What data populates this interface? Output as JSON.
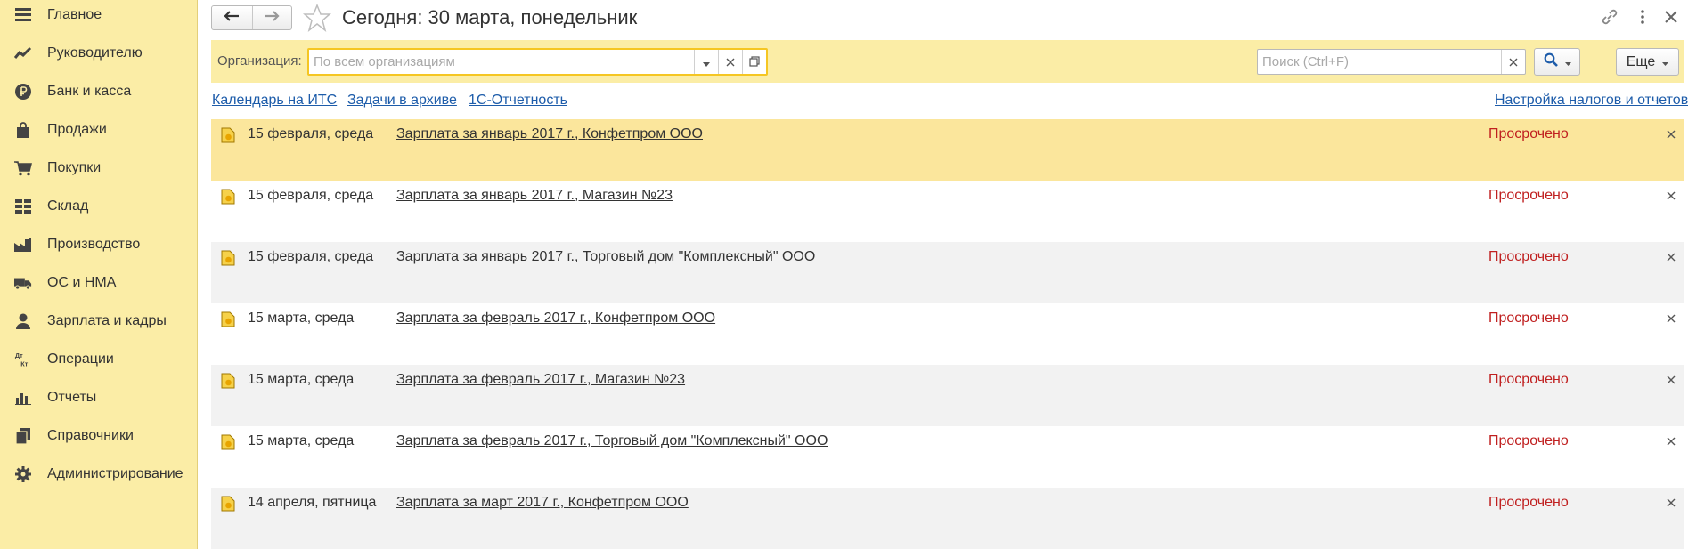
{
  "sidebar": {
    "items": [
      {
        "label": "Главное",
        "icon": "menu-lines-icon"
      },
      {
        "label": "Руководителю",
        "icon": "trend-chart-icon"
      },
      {
        "label": "Банк и касса",
        "icon": "ruble-coin-icon"
      },
      {
        "label": "Продажи",
        "icon": "shopping-bag-icon"
      },
      {
        "label": "Покупки",
        "icon": "shopping-cart-icon"
      },
      {
        "label": "Склад",
        "icon": "warehouse-grid-icon"
      },
      {
        "label": "Производство",
        "icon": "factory-icon"
      },
      {
        "label": "ОС и НМА",
        "icon": "truck-icon"
      },
      {
        "label": "Зарплата и кадры",
        "icon": "person-icon"
      },
      {
        "label": "Операции",
        "icon": "debit-credit-icon"
      },
      {
        "label": "Отчеты",
        "icon": "bar-chart-icon"
      },
      {
        "label": "Справочники",
        "icon": "books-icon"
      },
      {
        "label": "Администрирование",
        "icon": "gear-icon"
      }
    ],
    "debit_credit_glyph": "Дт\nКт"
  },
  "header": {
    "title": "Сегодня: 30 марта, понедельник"
  },
  "filter": {
    "org_label": "Организация:",
    "org_placeholder": "По всем организациям",
    "org_value": "",
    "search_placeholder": "Поиск (Ctrl+F)",
    "search_value": "",
    "more_label": "Еще"
  },
  "links": {
    "calendar": "Календарь на ИТС",
    "archive": "Задачи в архиве",
    "reporting": "1С-Отчетность",
    "settings": "Настройка налогов и отчетов"
  },
  "tasks": [
    {
      "date": "15 февраля, среда",
      "title": "Зарплата за январь 2017 г., Конфетпром ООО",
      "status": "Просрочено"
    },
    {
      "date": "15 февраля, среда",
      "title": "Зарплата за январь 2017 г., Магазин №23",
      "status": "Просрочено"
    },
    {
      "date": "15 февраля, среда",
      "title": "Зарплата за январь 2017 г., Торговый дом \"Комплексный\" ООО",
      "status": "Просрочено"
    },
    {
      "date": "15 марта, среда",
      "title": "Зарплата за февраль 2017 г., Конфетпром ООО",
      "status": "Просрочено"
    },
    {
      "date": "15 марта, среда",
      "title": "Зарплата за февраль 2017 г., Магазин №23",
      "status": "Просрочено"
    },
    {
      "date": "15 марта, среда",
      "title": "Зарплата за февраль 2017 г., Торговый дом \"Комплексный\" ООО",
      "status": "Просрочено"
    },
    {
      "date": "14 апреля, пятница",
      "title": "Зарплата за март 2017 г., Конфетпром ООО",
      "status": "Просрочено"
    }
  ],
  "colors": {
    "sidebar_bg": "#fbeda6",
    "selected_row": "#fbe69c",
    "overdue": "#c02020",
    "link": "#1d5caa",
    "focus_border": "#f5c623"
  }
}
